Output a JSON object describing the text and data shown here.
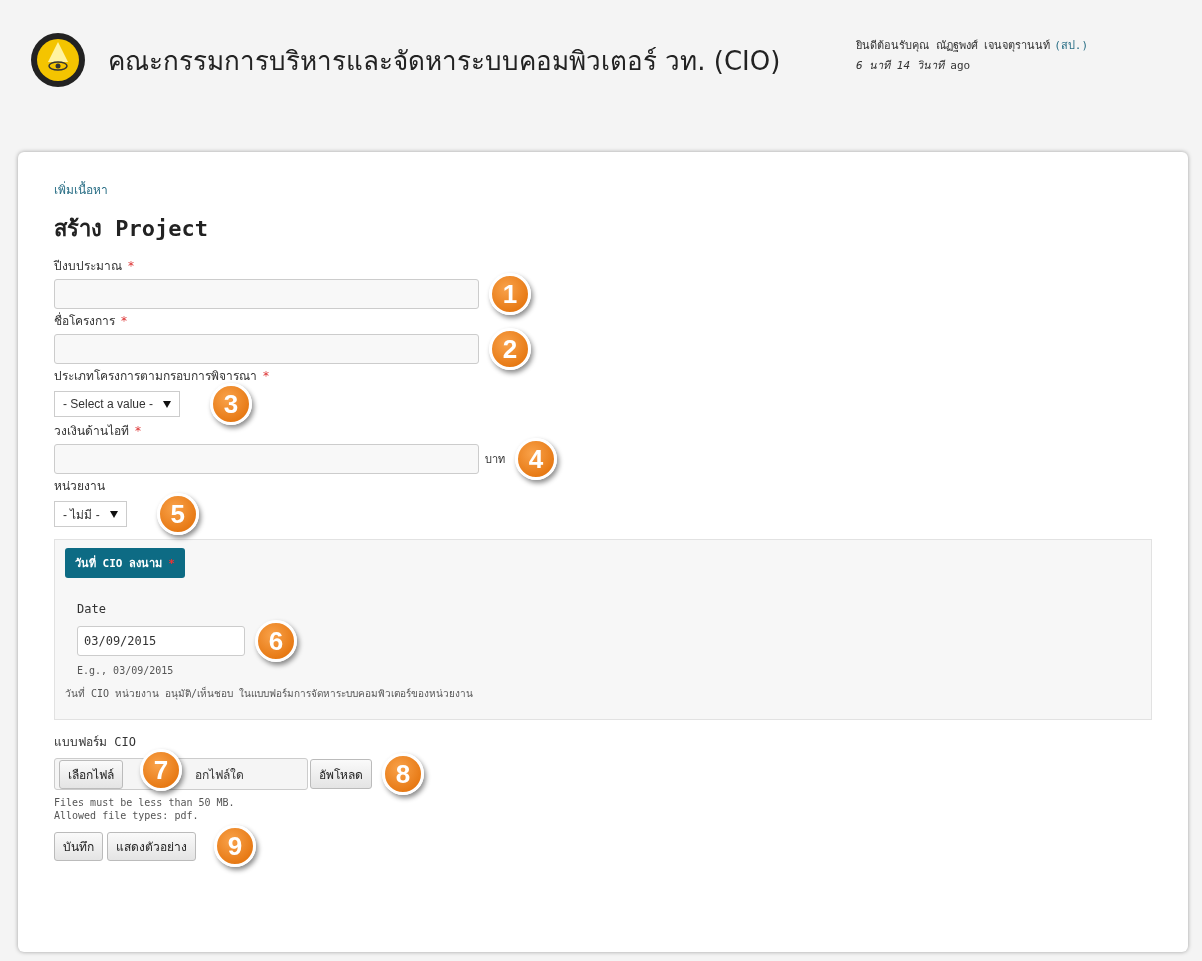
{
  "header": {
    "title": "คณะกรรมการบริหารและจัดหาระบบคอมพิวเตอร์ วท. (CIO)",
    "welcome": "ยินดีต้อนรับคุณ ณัฏฐพงศ์ เจนจตุรานนท์",
    "org": "(สป.)",
    "time": "*6 นาที 14 วินาที* ago"
  },
  "breadcrumb": "เพิ่มเนื้อหา",
  "page_title": "สร้าง Project",
  "fields": [
    {
      "kind": "text",
      "label": "ปีงบประมาณ",
      "required_mark": "*",
      "badge": "1"
    },
    {
      "kind": "text",
      "label": "ชื่อโครงการ",
      "required_mark": "*",
      "badge": "2"
    },
    {
      "kind": "select",
      "label": "ประเภทโครงการตามกรอบการพิจารณา",
      "required_mark": "*",
      "value": "- Select a value -",
      "badge": "3"
    },
    {
      "kind": "text",
      "label": "วงเงินด้านไอที",
      "required_mark": "*",
      "unit": "บาท",
      "badge": "4"
    },
    {
      "kind": "select",
      "label": "หน่วยงาน",
      "value": "- ไม่มี -",
      "badge": "5"
    }
  ],
  "date_group": {
    "legend": "วันที่ CIO ลงนาม",
    "required_mark": "*",
    "date_label": "Date",
    "value": "03/09/2015",
    "example": "E.g., 03/09/2015",
    "description": "วันที่ CIO หน่วยงาน อนุมัติ/เห็นชอบ ในแบบฟอร์มการจัดหาระบบคอมพิวเตอร์ของหน่วยงาน",
    "badge": "6"
  },
  "file_field": {
    "label": "แบบฟอร์ม CIO",
    "choose_button": "เลือกไฟล์",
    "status": "อกไฟล์ใด",
    "upload_button": "อัพโหลด",
    "badges": [
      "7",
      "8"
    ],
    "help": [
      "Files must be less than 50 MB.",
      "Allowed file types: pdf."
    ]
  },
  "actions": {
    "buttons": [
      "บันทึก",
      "แสดงตัวอย่าง"
    ],
    "badge": "9"
  }
}
